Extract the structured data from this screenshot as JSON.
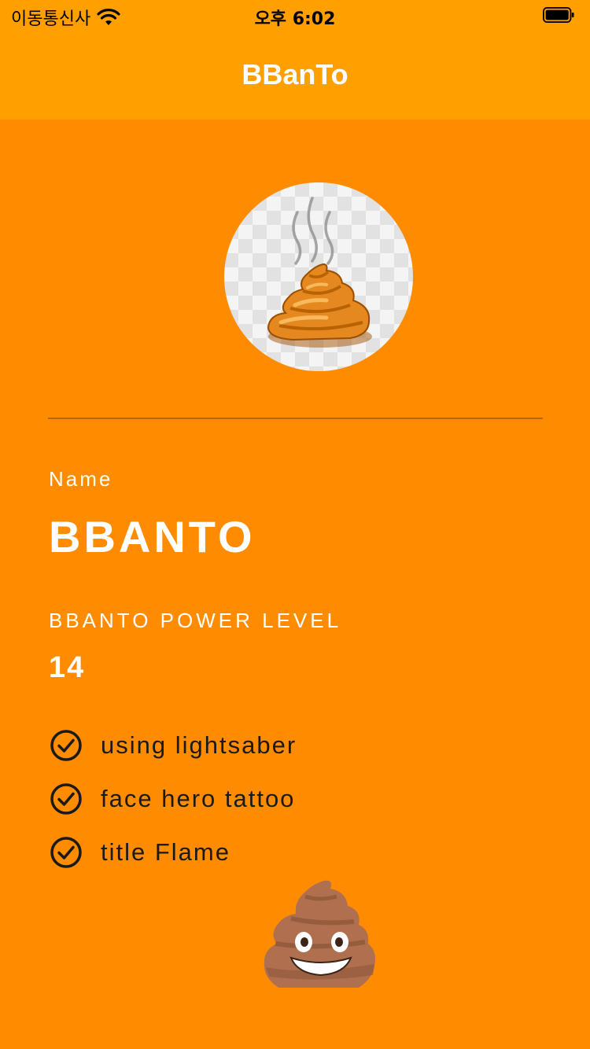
{
  "status_bar": {
    "carrier": "이동통신사",
    "time": "오후 6:02"
  },
  "nav": {
    "title": "BBanTo"
  },
  "profile": {
    "avatar_icon": "steaming-poop-icon",
    "name_label": "Name",
    "name_value": "BBANTO",
    "power_label": "BBANTO POWER LEVEL",
    "power_value": "14"
  },
  "abilities": [
    {
      "icon": "check-circle-icon",
      "label": "using lightsaber"
    },
    {
      "icon": "check-circle-icon",
      "label": "face hero tattoo"
    },
    {
      "icon": "check-circle-icon",
      "label": "title Flame"
    }
  ],
  "mascot_icon": "smiling-poop-icon",
  "colors": {
    "background": "#FF8C00",
    "navbar": "#FFA000",
    "text_primary": "#FFFFFF",
    "text_dark": "#1A1A1A"
  }
}
